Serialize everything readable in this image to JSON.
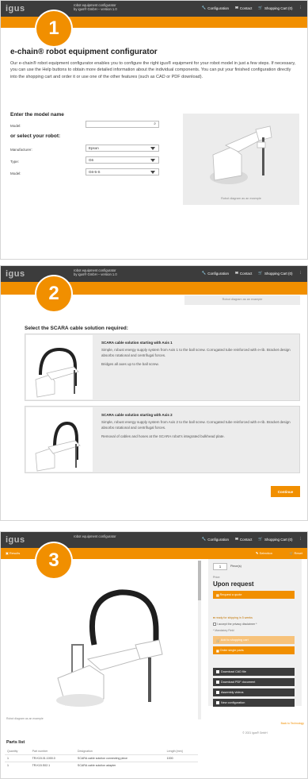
{
  "header": {
    "logo": "igus",
    "app_title_line1": "robot equipment configurator",
    "app_title_line2": "by igus® GmbH – version 1.0",
    "nav": [
      "Configuration",
      "Contact",
      "Shopping Cart (0)"
    ]
  },
  "steps": [
    "1",
    "2",
    "3"
  ],
  "panel1": {
    "title": "e-chain® robot equipment configurator",
    "intro": "Our e-chain® robot equipment configurator enables you to configure the right igus® equipment for your robot model in just a few steps. If necessary, you can use the Help buttons to obtain more detailed information about the individual components. You can put your finished configuration directly into the shopping cart and order it or use one of the other features (such as CAD or PDF download).",
    "model_heading": "Enter the model name",
    "model_label": "Model:",
    "select_heading": "or select your robot:",
    "fields": [
      {
        "label": "Manufacturer:",
        "value": "Epson"
      },
      {
        "label": "Type:",
        "value": "G6"
      },
      {
        "label": "Model:",
        "value": "G6-5-S"
      }
    ],
    "preview_caption": "Robot diagram as an example"
  },
  "panel2": {
    "caption_top": "Robot diagram as an example",
    "heading": "Select the SCARA cable solution required:",
    "options": [
      {
        "title": "SCARA cable solution starting with Axis 1",
        "desc": "Simple, robust energy supply system from Axis 1 to the ball screw. Corrugated tube reinforced with e-rib. Bracket design absorbs rotational and centrifugal forces.",
        "desc2": "Bridges all axes up to the ball screw."
      },
      {
        "title": "SCARA cable solution starting with Axis 2",
        "desc": "Simple, robust energy supply system from Axis 2 to the ball screw. Corrugated tube reinforced with e-rib. Bracket design absorbs rotational and centrifugal forces.",
        "desc2": "Removal of cables and hoses at the SCARA robot's integrated bulkhead plate."
      }
    ],
    "continue": "Continue"
  },
  "panel3": {
    "toolbar_left": "Results",
    "toolbar_right": [
      "Selection",
      "Reset"
    ],
    "qty": "1",
    "qty_label": "Piece(s)",
    "price_label": "Price:",
    "price": "Upon request",
    "quote_btn": "Request a quote",
    "ready": "ready for shipping in 5 weeks",
    "privacy": "I accept the privacy disclaimer *",
    "mandatory": "* Mandatory Field",
    "cart_btn": "Add to shopping cart",
    "single_btn": "Order single parts",
    "downloads": [
      "Download CAD file",
      "Download PDF document",
      "Assembly videos",
      "New configuration"
    ],
    "back_link": "Back to Technology",
    "copyright": "© 2021 igus® GmbH",
    "diagram_caption": "Robot diagram as an example",
    "parts_title": "Parts list",
    "parts_headers": [
      "Quantity",
      "Part number",
      "Designation",
      "Length [mm]"
    ],
    "parts_rows": [
      [
        "1",
        "TR.K15.01.1000.0",
        "SCARA cable solution connecting piece",
        "1000"
      ],
      [
        "1",
        "TR.K15.S02.1",
        "SCARA cable solution adapter",
        ""
      ]
    ]
  }
}
